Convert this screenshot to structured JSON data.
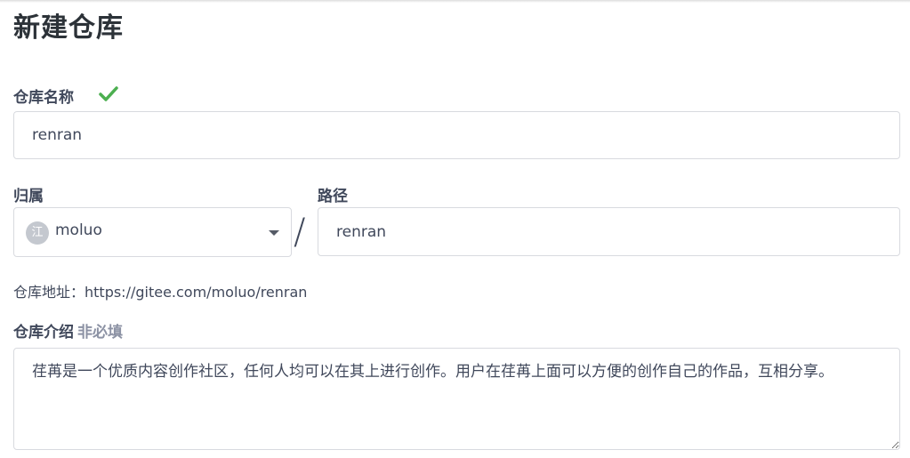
{
  "page": {
    "title": "新建仓库"
  },
  "repo_name": {
    "label": "仓库名称",
    "value": "renran",
    "valid": true
  },
  "owner": {
    "label": "归属",
    "avatar_text": "江",
    "value": "moluo"
  },
  "separator": "/",
  "path": {
    "label": "路径",
    "value": "renran"
  },
  "address": {
    "text": "仓库地址：https://gitee.com/moluo/renran"
  },
  "description": {
    "label": "仓库介绍",
    "optional_label": "非必填",
    "value": "荏苒是一个优质内容创作社区，任何人均可以在其上进行创作。用户在荏苒上面可以方便的创作自己的作品，互相分享。"
  },
  "colors": {
    "check": "#4caf50",
    "text": "#40485b",
    "border": "#d8dadf",
    "muted": "#8c92a4"
  }
}
